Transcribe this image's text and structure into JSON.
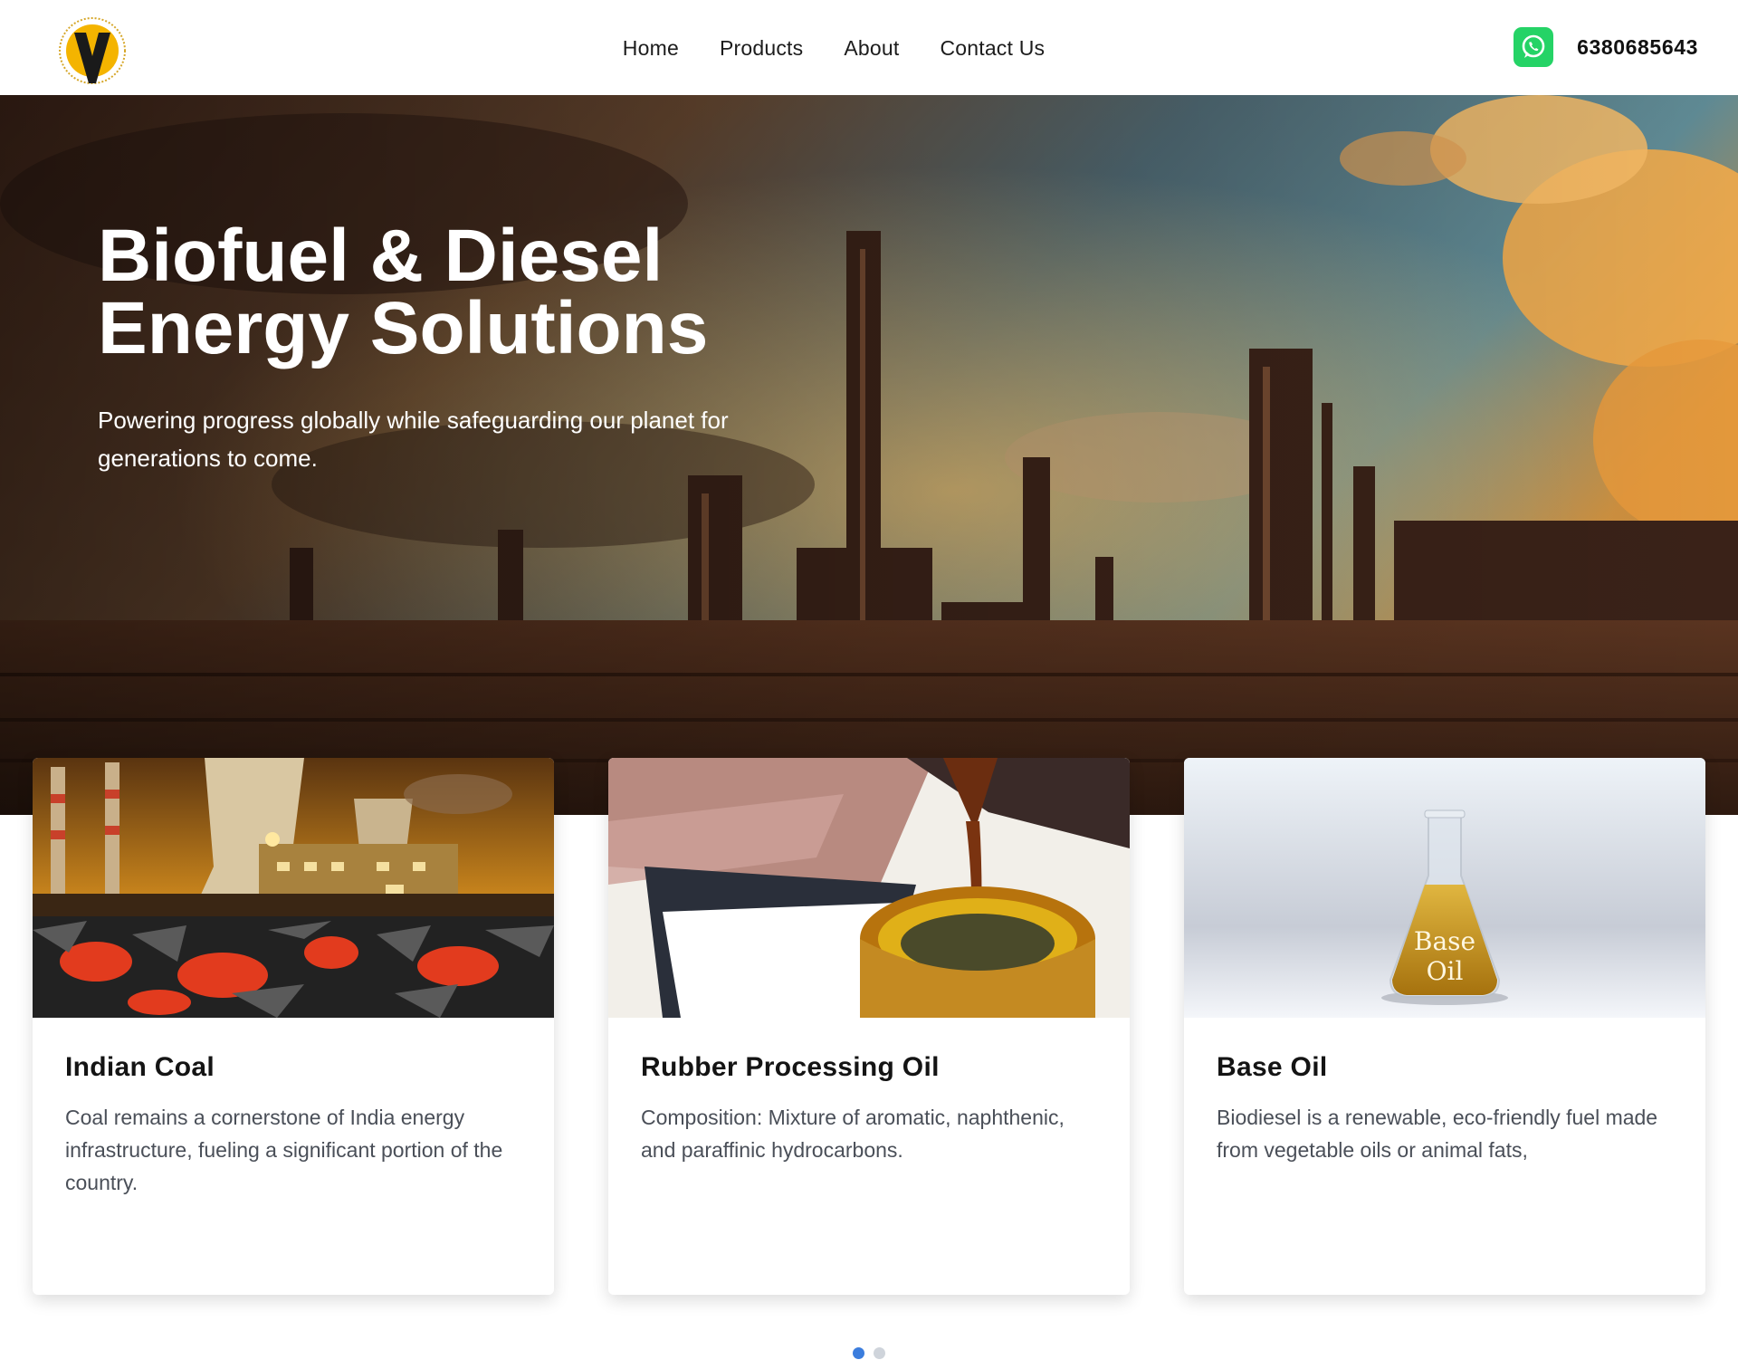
{
  "header": {
    "nav": [
      {
        "label": "Home"
      },
      {
        "label": "Products"
      },
      {
        "label": "About"
      },
      {
        "label": "Contact Us"
      }
    ],
    "phone": "6380685643",
    "whatsapp_color": "#25d366"
  },
  "hero": {
    "title_line1": "Biofuel & Diesel",
    "title_line2": "Energy Solutions",
    "subtitle": "Powering progress globally while safeguarding our planet for generations to come."
  },
  "cards": [
    {
      "title": "Indian Coal",
      "text": "Coal remains a cornerstone of India energy infrastructure, fueling a significant portion of the country."
    },
    {
      "title": "Rubber Processing Oil",
      "text": "Composition: Mixture of aromatic, naphthenic, and paraffinic hydrocarbons."
    },
    {
      "title": "Base Oil",
      "text": "Biodiesel is a renewable, eco-friendly fuel made from vegetable oils or animal fats,",
      "image_label_1": "Base",
      "image_label_2": "Oil"
    }
  ],
  "carousel": {
    "total": 2,
    "active": 1,
    "active_color": "#3b7ddd"
  }
}
